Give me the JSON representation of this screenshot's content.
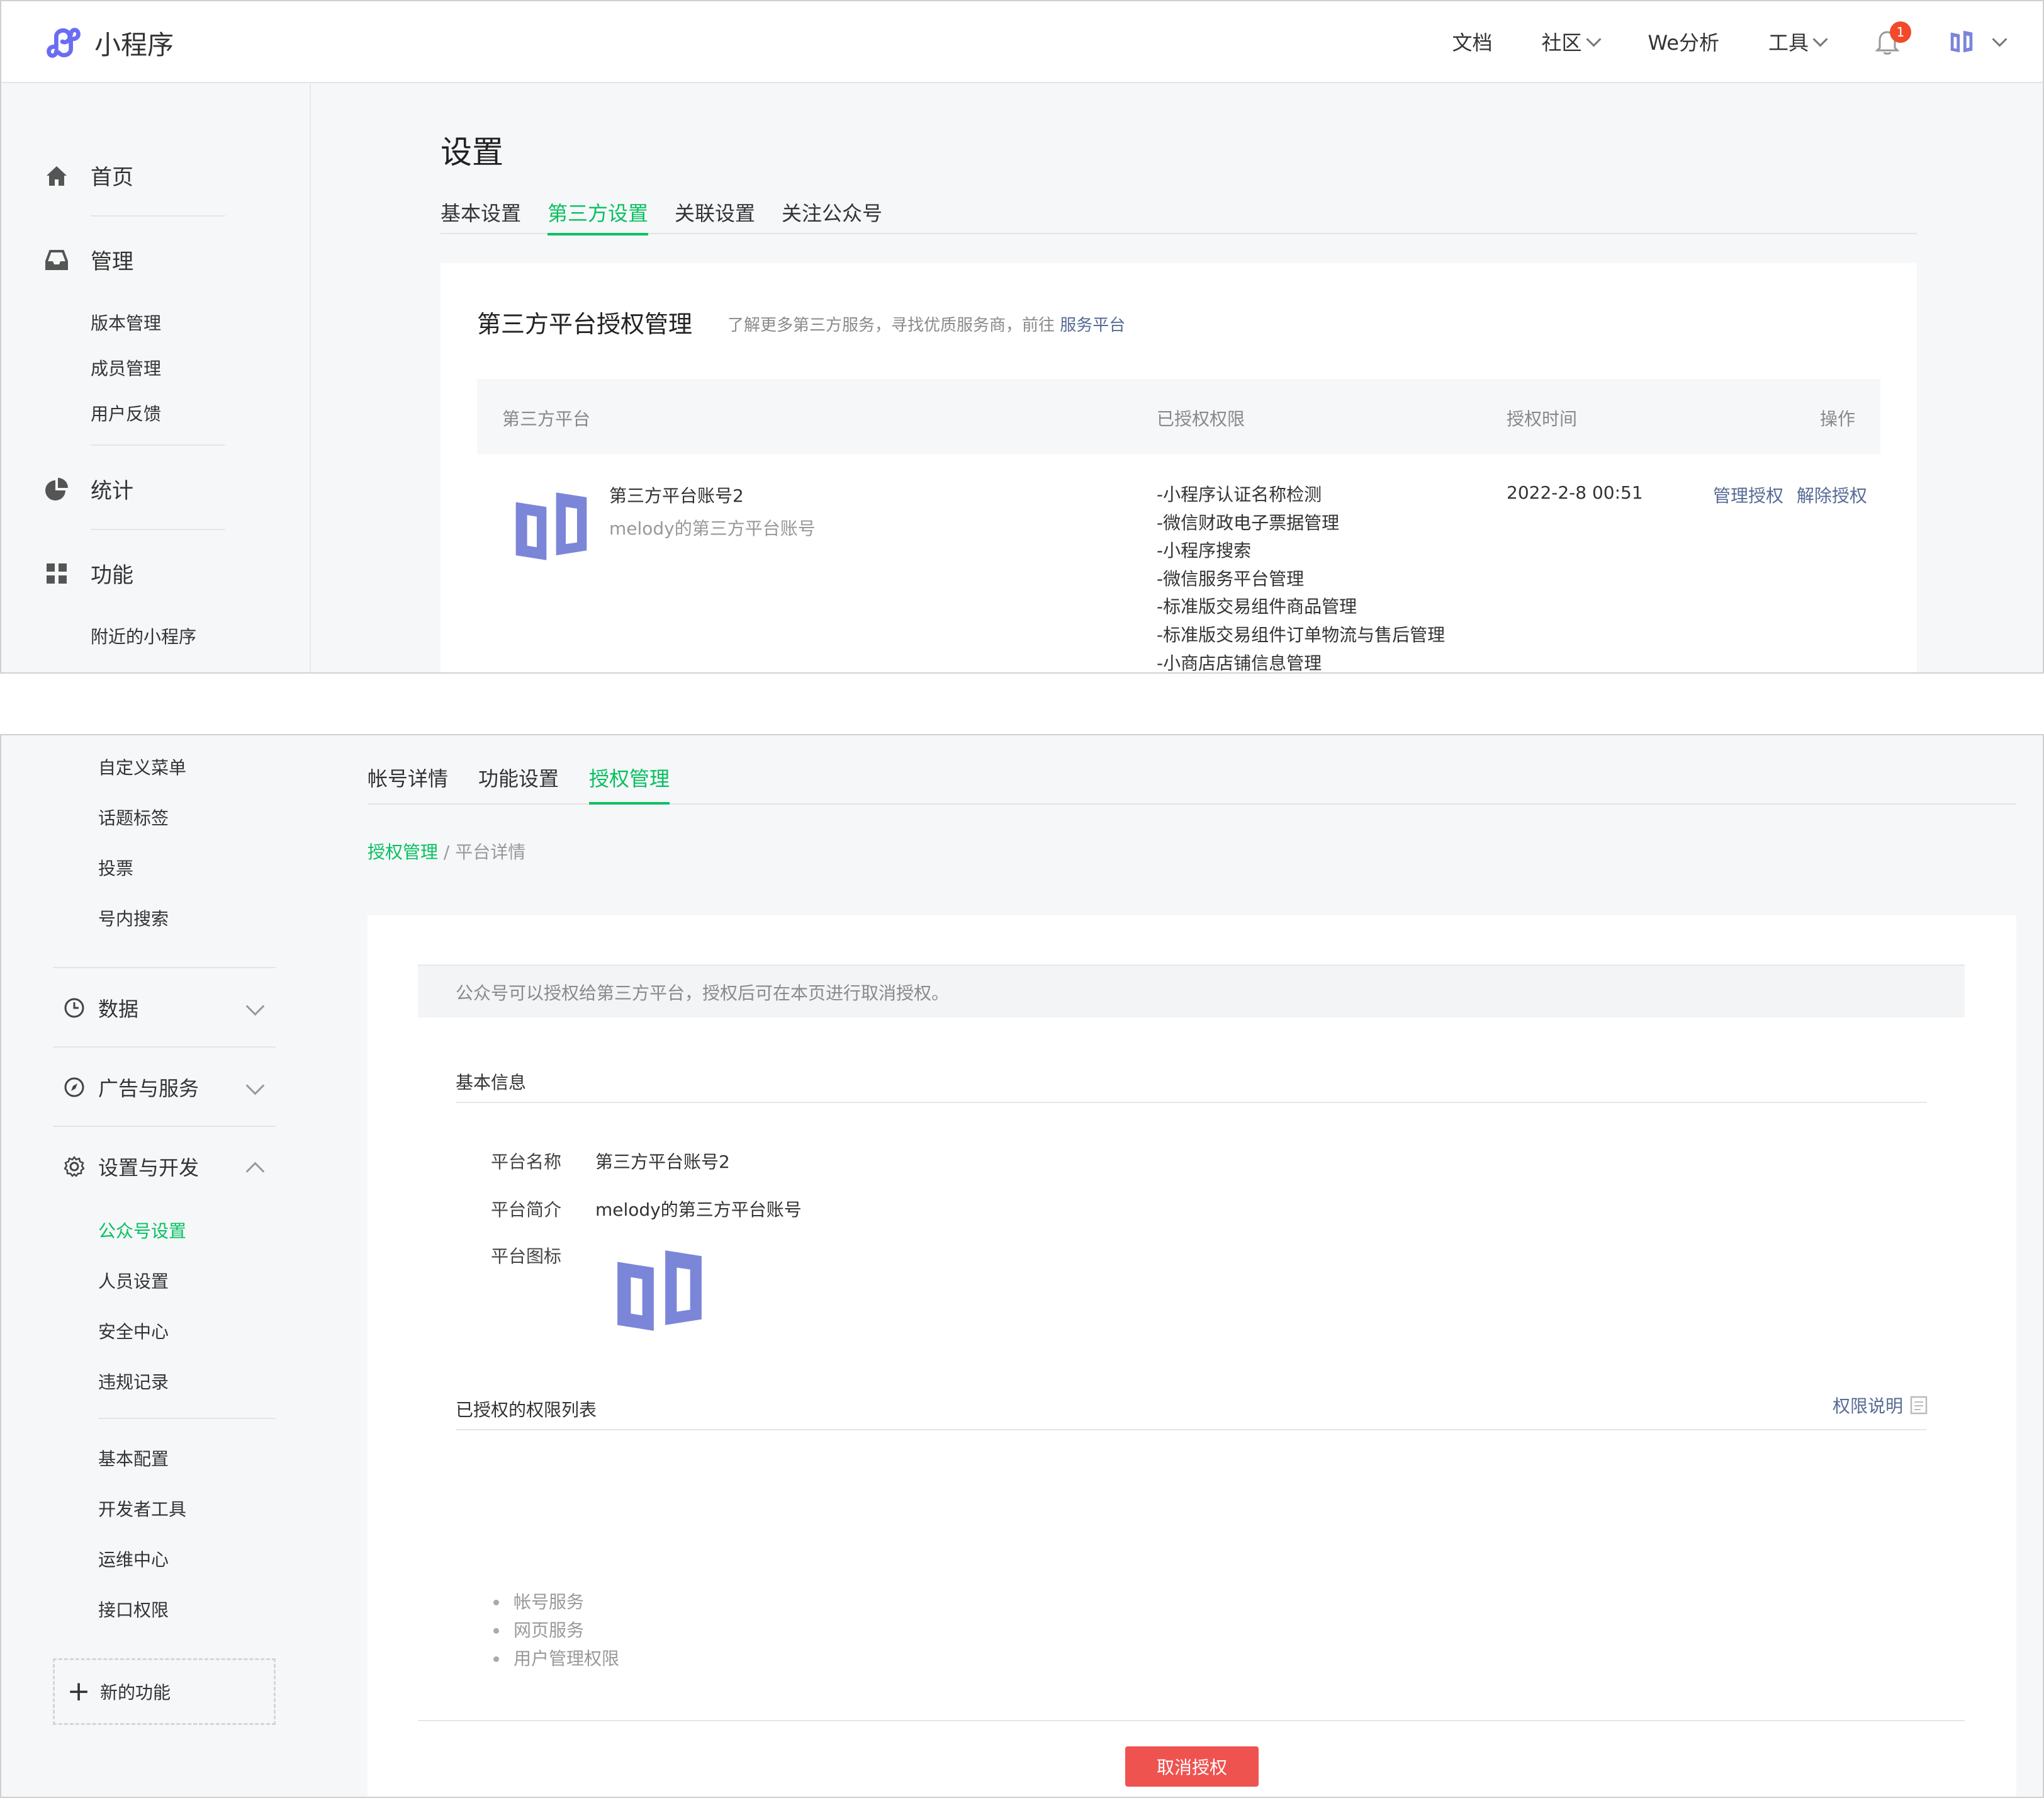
{
  "panel1": {
    "app_title": "小程序",
    "nav": {
      "docs": "文档",
      "community": "社区",
      "analysis": "We分析",
      "tools": "工具",
      "notification_count": "1"
    },
    "sidebar": {
      "home": "首页",
      "manage": "管理",
      "manage_items": [
        "版本管理",
        "成员管理",
        "用户反馈"
      ],
      "stats": "统计",
      "features": "功能",
      "feature_items": [
        "附近的小程序"
      ]
    },
    "page_title": "设置",
    "tabs": [
      "基本设置",
      "第三方设置",
      "关联设置",
      "关注公众号"
    ],
    "active_tab": 1,
    "card": {
      "title": "第三方平台授权管理",
      "hint_prefix": "了解更多第三方服务，寻找优质服务商，前往",
      "hint_link": "服务平台",
      "columns": [
        "第三方平台",
        "已授权权限",
        "授权时间",
        "操作"
      ],
      "row": {
        "name": "第三方平台账号2",
        "desc": "melody的第三方平台账号",
        "permissions": [
          "-小程序认证名称检测",
          "-微信财政电子票据管理",
          "-小程序搜索",
          "-微信服务平台管理",
          "-标准版交易组件商品管理",
          "-标准版交易组件订单物流与售后管理",
          "-小商店店铺信息管理"
        ],
        "time": "2022-2-8 00:51",
        "actions": [
          "管理授权",
          "解除授权"
        ]
      }
    }
  },
  "panel2": {
    "sidebar": {
      "top_items": [
        "自定义菜单",
        "话题标签",
        "投票",
        "号内搜索"
      ],
      "groups": [
        "数据",
        "广告与服务",
        "设置与开发"
      ],
      "settings_items": [
        "公众号设置",
        "人员设置",
        "安全中心",
        "违规记录"
      ],
      "dev_items": [
        "基本配置",
        "开发者工具",
        "运维中心",
        "接口权限"
      ],
      "new_feature": "新的功能"
    },
    "tabs": [
      "帐号详情",
      "功能设置",
      "授权管理"
    ],
    "active_tab": 2,
    "breadcrumb": {
      "link": "授权管理",
      "separator": "/",
      "current": "平台详情"
    },
    "notice": "公众号可以授权给第三方平台，授权后可在本页进行取消授权。",
    "basic_info": {
      "title": "基本信息",
      "name_label": "平台名称",
      "name_value": "第三方平台账号2",
      "desc_label": "平台简介",
      "desc_value": "melody的第三方平台账号",
      "icon_label": "平台图标"
    },
    "permissions": {
      "title": "已授权的权限列表",
      "doc_link": "权限说明",
      "items": [
        "帐号服务",
        "网页服务",
        "用户管理权限"
      ]
    },
    "revoke_button": "取消授权"
  },
  "colors": {
    "accent_green": "#07c160",
    "link_blue": "#576b95",
    "danger_red": "#ef5350",
    "badge_red": "#f04a2b",
    "logo_purple": "#6a6df2",
    "platform_logo": "#7b86d8"
  },
  "icons": {
    "home": "home-icon",
    "manage": "inbox-icon",
    "stats": "pie-chart-icon",
    "features": "grid-icon",
    "data": "clock-icon",
    "ads": "compass-icon",
    "settings": "gear-icon"
  }
}
